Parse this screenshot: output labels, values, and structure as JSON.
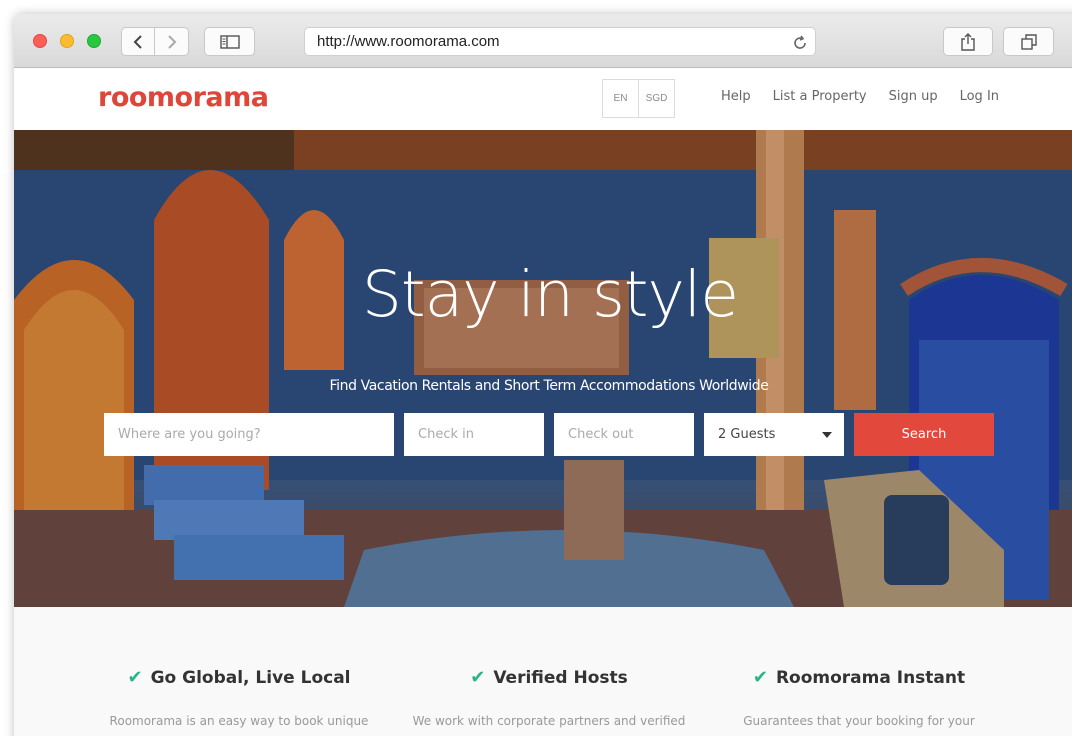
{
  "browser": {
    "url": "http://www.roomorama.com"
  },
  "header": {
    "logo": "roomorama",
    "languages": [
      "EN",
      "SGD"
    ],
    "nav": [
      "Help",
      "List a Property",
      "Sign up",
      "Log In"
    ]
  },
  "hero": {
    "title": "Stay in style",
    "subtitle": "Find Vacation Rentals and Short Term Accommodations Worldwide",
    "where_placeholder": "Where are you going?",
    "checkin_placeholder": "Check in",
    "checkout_placeholder": "Check out",
    "guests_value": "2 Guests",
    "search_label": "Search"
  },
  "features": [
    {
      "title": "Go Global, Live Local",
      "desc": "Roomorama is an easy way to book unique"
    },
    {
      "title": "Verified Hosts",
      "desc": "We work with corporate partners and verified"
    },
    {
      "title": "Roomorama Instant",
      "desc": "Guarantees that your booking for your"
    }
  ],
  "colors": {
    "brand": "#e0453a",
    "check": "#2bb389"
  }
}
